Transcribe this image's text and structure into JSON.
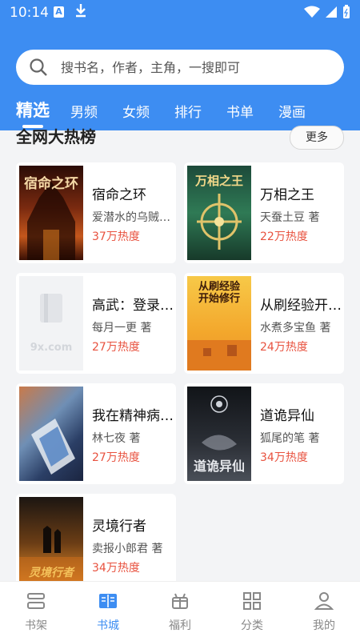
{
  "status": {
    "time": "10:14",
    "a_badge": "A"
  },
  "search": {
    "placeholder": "搜书名，作者，主角，一搜即可"
  },
  "tabs": [
    "精选",
    "男频",
    "女频",
    "排行",
    "书单",
    "漫画"
  ],
  "section": {
    "title": "全网大热榜",
    "more": "更多"
  },
  "books": [
    {
      "title": "宿命之环",
      "author": "爱潜水的乌贼 著",
      "heat": "37万热度",
      "cover_text": "宿命之环"
    },
    {
      "title": "万相之王",
      "author": "天蚕土豆 著",
      "heat": "22万热度",
      "cover_text": "万相之王"
    },
    {
      "title": "高武：登录未来一万年",
      "author": "每月一更 著",
      "heat": "27万热度",
      "cover_text": "9x.com"
    },
    {
      "title": "从刷经验开始修行",
      "author": "水煮多宝鱼 著",
      "heat": "24万热度",
      "cover_text": "从刷经验开始修行"
    },
    {
      "title": "我在精神病院学斩神",
      "author": "林七夜 著",
      "heat": "27万热度",
      "cover_text": ""
    },
    {
      "title": "道诡异仙",
      "author": "狐尾的笔 著",
      "heat": "34万热度",
      "cover_text": "道诡异仙"
    },
    {
      "title": "灵境行者",
      "author": "卖报小郎君 著",
      "heat": "34万热度",
      "cover_text": "灵境行者"
    }
  ],
  "nav": [
    {
      "label": "书架",
      "icon": "bookshelf-icon"
    },
    {
      "label": "书城",
      "icon": "book-open-icon"
    },
    {
      "label": "福利",
      "icon": "gift-icon"
    },
    {
      "label": "分类",
      "icon": "grid-icon"
    },
    {
      "label": "我的",
      "icon": "user-icon"
    }
  ],
  "colors": {
    "accent": "#3d8df2",
    "heat": "#e8523f"
  }
}
